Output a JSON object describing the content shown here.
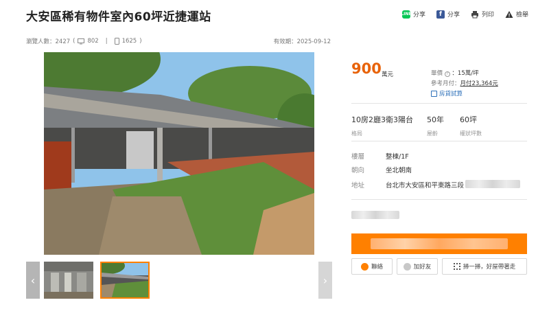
{
  "title": "大安區稀有物件室內60坪近捷運站",
  "share": [
    {
      "label": "分享",
      "icon": "line-icon"
    },
    {
      "label": "分享",
      "icon": "facebook-icon"
    },
    {
      "label": "列印",
      "icon": "printer-icon"
    },
    {
      "label": "檢舉",
      "icon": "warning-icon"
    }
  ],
  "stats": {
    "views_label": "瀏覽人數：2427",
    "desktop_count": "802",
    "mobile_count": "1625"
  },
  "expiry": "有效期：2025-09-12",
  "price": {
    "value": "900",
    "unit": "萬元",
    "unit_price_label": "單價",
    "unit_price_value": "：15萬/坪",
    "monthly_label": "參考月付：",
    "monthly_value": "月付23,364元",
    "loan_label": "房貸試算"
  },
  "specs": [
    {
      "value": "10房2廳3衛3陽台",
      "label": "格局"
    },
    {
      "value": "50年",
      "label": "屋齡"
    },
    {
      "value": "60坪",
      "label": "權狀坪數"
    }
  ],
  "details": [
    {
      "key": "樓層",
      "value": "整棟/1F"
    },
    {
      "key": "朝向",
      "value": "坐北朝南"
    },
    {
      "key": "地址",
      "value": "台北市大安區和平東路三段"
    }
  ],
  "actions": [
    {
      "label": "聯絡",
      "icon": "chat-icon"
    },
    {
      "label": "加好友",
      "icon": "line-icon"
    },
    {
      "label": "掃一掃，好屋帶著走",
      "icon": "qrcode-icon"
    }
  ],
  "nav": {
    "prev": "‹",
    "next": "›"
  },
  "colors": {
    "accent": "#ff8000",
    "price": "#e8630a",
    "link": "#2a6eb8"
  }
}
